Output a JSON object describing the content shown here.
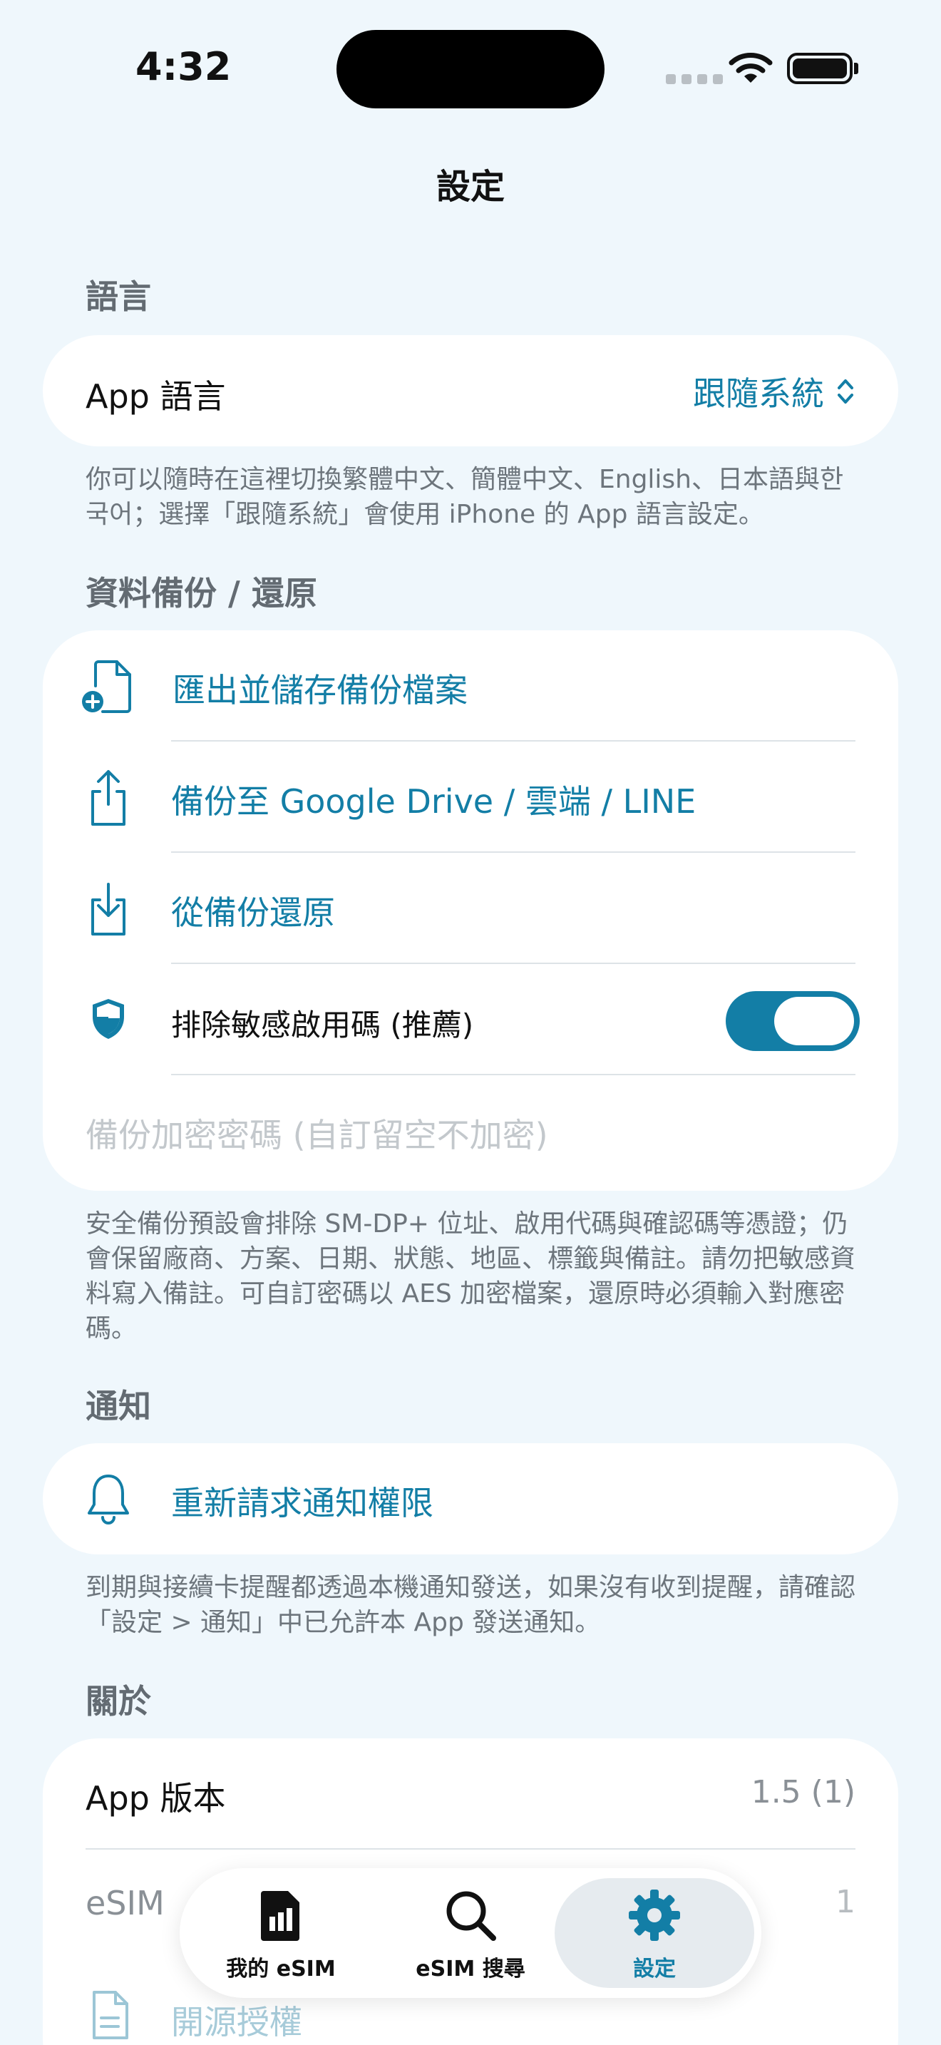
{
  "status_bar": {
    "time": "4:32"
  },
  "nav": {
    "title": "設定"
  },
  "language": {
    "header": "語言",
    "row_label": "App 語言",
    "row_value": "跟隨系統",
    "footer": "你可以隨時在這裡切換繁體中文、簡體中文、English、日本語與한국어；選擇「跟隨系統」會使用 iPhone 的 App 語言設定。"
  },
  "backup": {
    "header": "資料備份 / 還原",
    "export_label": "匯出並儲存備份檔案",
    "share_label": "備份至 Google Drive / 雲端 / LINE",
    "restore_label": "從備份還原",
    "exclude_label": "排除敏感啟用碼 (推薦)",
    "exclude_on": true,
    "password_placeholder": "備份加密密碼 (自訂留空不加密)",
    "footer": "安全備份預設會排除 SM-DP+ 位址、啟用代碼與確認碼等憑證；仍會保留廠商、方案、日期、狀態、地區、標籤與備註。請勿把敏感資料寫入備註。可自訂密碼以 AES 加密檔案，還原時必須輸入對應密碼。"
  },
  "notifications": {
    "header": "通知",
    "request_label": "重新請求通知權限",
    "footer": "到期與接續卡提醒都透過本機通知發送，如果沒有收到提醒，請確認「設定 > 通知」中已允許本 App 發送通知。"
  },
  "about": {
    "header": "關於",
    "version_label": "App 版本",
    "version_value": "1.5 (1)",
    "esim_label": "eSIM",
    "esim_value": "1",
    "license_label": "開源授權"
  },
  "tabbar": {
    "tabs": [
      {
        "label": "我的 eSIM",
        "icon": "sim-card-icon",
        "active": false
      },
      {
        "label": "eSIM 搜尋",
        "icon": "magnifier-icon",
        "active": false
      },
      {
        "label": "設定",
        "icon": "gear-icon",
        "active": true
      }
    ]
  },
  "colors": {
    "accent": "#137ea6",
    "background": "#eff7fc",
    "card": "#ffffff"
  }
}
